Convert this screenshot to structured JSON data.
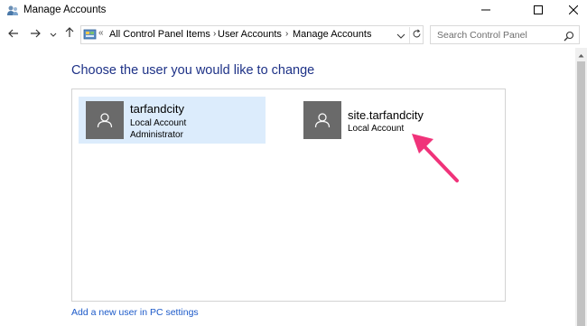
{
  "window": {
    "title": "Manage Accounts",
    "icons": {
      "app": "users-icon",
      "minimize": "minimize-icon",
      "maximize": "maximize-icon",
      "close": "close-icon"
    }
  },
  "nav": {
    "icons": {
      "back": "arrow-left-icon",
      "forward": "arrow-right-icon",
      "recent": "chevron-down-icon",
      "up": "arrow-up-icon",
      "refresh": "refresh-icon"
    },
    "address_sep": "«",
    "breadcrumbs": [
      "All Control Panel Items",
      "User Accounts",
      "Manage Accounts"
    ],
    "search_placeholder": "Search Control Panel"
  },
  "main": {
    "heading": "Choose the user you would like to change",
    "accounts": [
      {
        "name": "tarfandcity",
        "type": "Local Account",
        "role": "Administrator",
        "selected": true
      },
      {
        "name": "site.tarfandcity",
        "type": "Local Account",
        "selected": false
      }
    ],
    "add_user_link": "Add a new user in PC settings"
  },
  "colors": {
    "heading": "#1e3287",
    "link": "#1c5ac9",
    "selected_bg": "#dcecfc",
    "avatar_bg": "#6a6a6a",
    "annotation_arrow": "#f0337a"
  }
}
